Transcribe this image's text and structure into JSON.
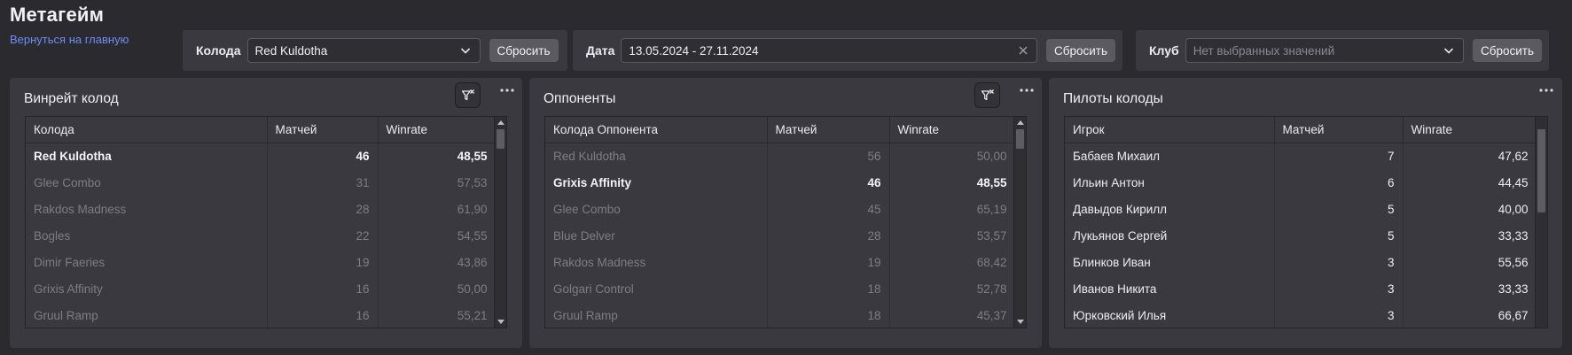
{
  "header": {
    "title": "Метагейм",
    "back_link": "Вернуться на главную"
  },
  "filters": {
    "deck": {
      "label": "Колода",
      "value": "Red Kuldotha",
      "reset": "Сбросить"
    },
    "date": {
      "label": "Дата",
      "value": "13.05.2024 - 27.11.2024",
      "reset": "Сбросить"
    },
    "club": {
      "label": "Клуб",
      "placeholder": "Нет выбранных значений",
      "reset": "Сбросить"
    }
  },
  "panels": {
    "winrate": {
      "title": "Винрейт колод",
      "columns": [
        "Колода",
        "Матчей",
        "Winrate"
      ],
      "rows": [
        {
          "name": "Red Kuldotha",
          "matches": "46",
          "winrate": "48,55",
          "state": "active"
        },
        {
          "name": "Glee Combo",
          "matches": "31",
          "winrate": "57,53",
          "state": "muted"
        },
        {
          "name": "Rakdos Madness",
          "matches": "28",
          "winrate": "61,90",
          "state": "muted"
        },
        {
          "name": "Bogles",
          "matches": "22",
          "winrate": "54,55",
          "state": "muted"
        },
        {
          "name": "Dimir Faeries",
          "matches": "19",
          "winrate": "43,86",
          "state": "muted"
        },
        {
          "name": "Grixis Affinity",
          "matches": "16",
          "winrate": "50,00",
          "state": "muted"
        },
        {
          "name": "Gruul Ramp",
          "matches": "16",
          "winrate": "55,21",
          "state": "muted"
        }
      ]
    },
    "opponents": {
      "title": "Оппоненты",
      "columns": [
        "Колода Оппонента",
        "Матчей",
        "Winrate"
      ],
      "rows": [
        {
          "name": "Red Kuldotha",
          "matches": "56",
          "winrate": "50,00",
          "state": "muted"
        },
        {
          "name": "Grixis Affinity",
          "matches": "46",
          "winrate": "48,55",
          "state": "active"
        },
        {
          "name": "Glee Combo",
          "matches": "45",
          "winrate": "65,19",
          "state": "muted"
        },
        {
          "name": "Blue Delver",
          "matches": "28",
          "winrate": "53,57",
          "state": "muted"
        },
        {
          "name": "Rakdos Madness",
          "matches": "19",
          "winrate": "68,42",
          "state": "muted"
        },
        {
          "name": "Golgari Control",
          "matches": "18",
          "winrate": "52,78",
          "state": "muted"
        },
        {
          "name": "Gruul Ramp",
          "matches": "18",
          "winrate": "45,37",
          "state": "muted"
        }
      ]
    },
    "pilots": {
      "title": "Пилоты колоды",
      "columns": [
        "Игрок",
        "Матчей",
        "Winrate"
      ],
      "rows": [
        {
          "name": "Бабаев Михаил",
          "matches": "7",
          "winrate": "47,62",
          "state": "normal"
        },
        {
          "name": "Ильин Антон",
          "matches": "6",
          "winrate": "44,45",
          "state": "normal"
        },
        {
          "name": "Давыдов Кирилл",
          "matches": "5",
          "winrate": "40,00",
          "state": "normal"
        },
        {
          "name": "Лукьянов Сергей",
          "matches": "5",
          "winrate": "33,33",
          "state": "normal"
        },
        {
          "name": "Блинков Иван",
          "matches": "3",
          "winrate": "55,56",
          "state": "normal"
        },
        {
          "name": "Иванов Никита",
          "matches": "3",
          "winrate": "33,33",
          "state": "normal"
        },
        {
          "name": "Юрковский Илья",
          "matches": "3",
          "winrate": "66,67",
          "state": "normal"
        }
      ]
    }
  }
}
